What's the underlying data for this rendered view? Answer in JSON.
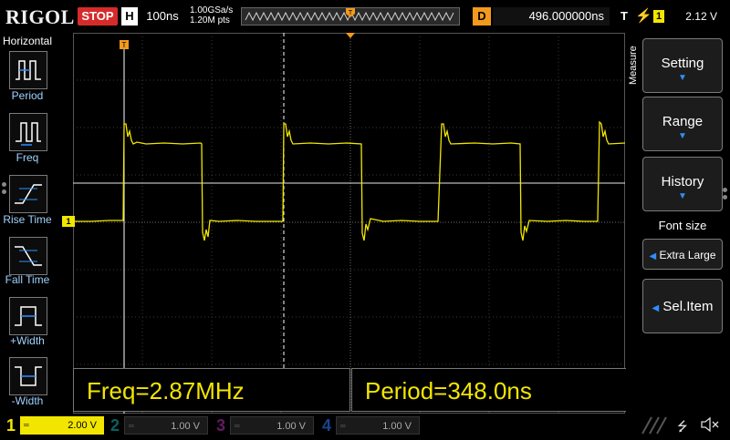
{
  "header": {
    "brand": "RIGOL",
    "run_state": "STOP",
    "horizontal_key": "H",
    "timebase": "100ns",
    "sample_rate": "1.00GSa/s",
    "memory_depth": "1.20M pts",
    "delay_key": "D",
    "delay_value": "496.000000ns",
    "trigger_key": "T",
    "trigger_source": "1",
    "trigger_level": "2.12 V"
  },
  "left_panel": {
    "title": "Horizontal",
    "items": [
      {
        "label": "Period",
        "icon": "period-icon"
      },
      {
        "label": "Freq",
        "icon": "freq-icon"
      },
      {
        "label": "Rise Time",
        "icon": "rise-time-icon"
      },
      {
        "label": "Fall Time",
        "icon": "fall-time-icon"
      },
      {
        "label": "+Width",
        "icon": "positive-width-icon"
      },
      {
        "label": "-Width",
        "icon": "negative-width-icon"
      }
    ]
  },
  "measurements": {
    "freq": "Freq=2.87MHz",
    "period": "Period=348.0ns"
  },
  "right_panel": {
    "tab": "Measure",
    "setting": "Setting",
    "range": "Range",
    "history": "History",
    "font_size_label": "Font size",
    "font_size_value": "Extra Large",
    "sel_item": "Sel.Item"
  },
  "markers": {
    "ch1_marker": "1",
    "trigger_marker": "T"
  },
  "channels": [
    {
      "num": "1",
      "scale": "2.00 V",
      "color": "#f2e600",
      "active": true
    },
    {
      "num": "2",
      "scale": "1.00 V",
      "color": "#17d4d6",
      "active": false
    },
    {
      "num": "3",
      "scale": "1.00 V",
      "color": "#d43cd4",
      "active": false
    },
    {
      "num": "4",
      "scale": "1.00 V",
      "color": "#2a7fff",
      "active": false
    }
  ],
  "colors": {
    "trace": "#f2e600",
    "trigger": "#f29a1d",
    "stop": "#d62b2b",
    "accent": "#2f8fff"
  }
}
